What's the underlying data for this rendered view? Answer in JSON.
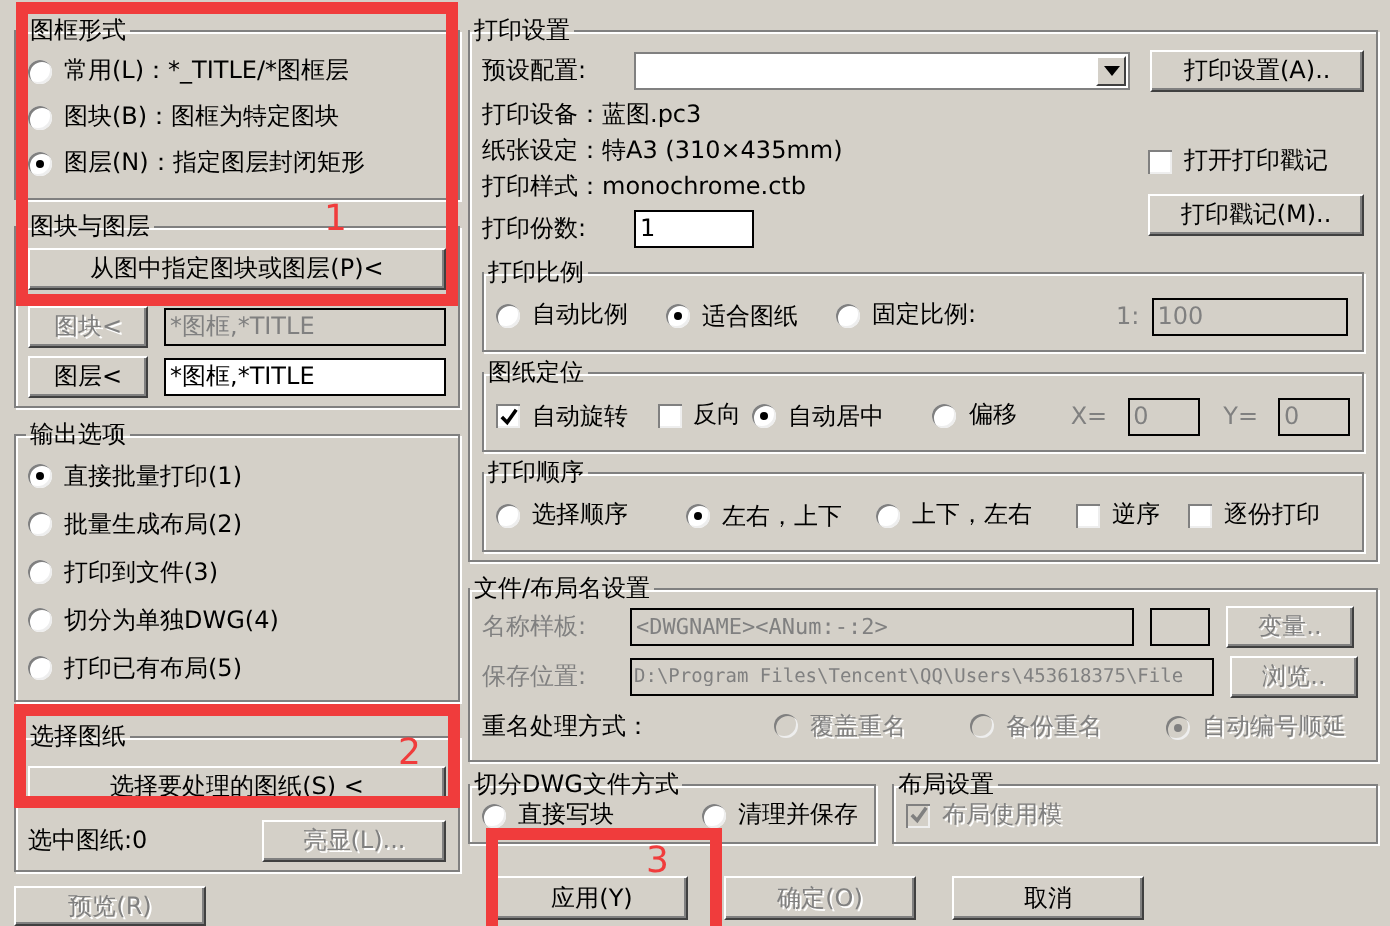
{
  "frame_style": {
    "title": "图框形式",
    "options": [
      {
        "label": "常用(L)：*_TITLE/*图框层",
        "selected": false
      },
      {
        "label": "图块(B)：图框为特定图块",
        "selected": false
      },
      {
        "label": "图层(N)：指定图层封闭矩形",
        "selected": true
      }
    ]
  },
  "block_layer": {
    "title": "图块与图层",
    "pick_button": "从图中指定图块或图层(P)<",
    "rows": [
      {
        "button": "图块<",
        "value": "*图框,*TITLE",
        "disabled": true
      },
      {
        "button": "图层<",
        "value": "*图框,*TITLE",
        "disabled": false
      }
    ]
  },
  "output": {
    "title": "输出选项",
    "options": [
      {
        "label": "直接批量打印(1)",
        "selected": true
      },
      {
        "label": "批量生成布局(2)",
        "selected": false
      },
      {
        "label": "打印到文件(3)",
        "selected": false
      },
      {
        "label": "切分为单独DWG(4)",
        "selected": false
      },
      {
        "label": "打印已有布局(5)",
        "selected": false
      }
    ]
  },
  "select_sheets": {
    "title": "选择图纸",
    "button": "选择要处理的图纸(S) <",
    "count": "选中图纸:0",
    "highlight_button": {
      "label": "亮显(L)...",
      "disabled": true
    }
  },
  "preview_button": {
    "label": "预览(R)",
    "disabled": true
  },
  "print_settings": {
    "title": "打印设置",
    "preset_label": "预设配置:",
    "setup_button": "打印设置(A)..",
    "info": [
      "打印设备：蓝图.pc3",
      "纸张设定：特A3 (310×435mm)",
      "打印样式：monochrome.ctb"
    ],
    "stamp_checkbox": {
      "label": "打开打印戳记",
      "checked": false
    },
    "stamp_button": "打印戳记(M)..",
    "copies_label": "打印份数:",
    "copies": "1",
    "scale": {
      "title": "打印比例",
      "options": [
        {
          "label": "自动比例",
          "selected": false
        },
        {
          "label": "适合图纸",
          "selected": true
        },
        {
          "label": "固定比例:",
          "selected": false
        }
      ],
      "ratio_label": "1:",
      "ratio": "100",
      "ratio_disabled": true
    },
    "placement": {
      "title": "图纸定位",
      "items": [
        {
          "kind": "checkbox",
          "label": "自动旋转",
          "checked": true
        },
        {
          "kind": "checkbox",
          "label": "反向",
          "checked": false
        },
        {
          "kind": "radio",
          "label": "自动居中",
          "selected": true
        },
        {
          "kind": "radio",
          "label": "偏移",
          "selected": false
        },
        {
          "kind": "field",
          "label": "X=",
          "value": "0",
          "disabled": true
        },
        {
          "kind": "field",
          "label": "Y=",
          "value": "0",
          "disabled": true
        }
      ]
    },
    "order": {
      "title": "打印顺序",
      "items": [
        {
          "kind": "radio",
          "label": "选择顺序",
          "selected": false
        },
        {
          "kind": "radio",
          "label": "左右，上下",
          "selected": true
        },
        {
          "kind": "radio",
          "label": "上下，左右",
          "selected": false
        },
        {
          "kind": "checkbox",
          "label": "逆序",
          "checked": false
        },
        {
          "kind": "checkbox",
          "label": "逐份打印",
          "checked": false
        }
      ]
    }
  },
  "file_names": {
    "title": "文件/布局名设置",
    "disabled": true,
    "template_label": "名称样板:",
    "template": "<DWGNAME><ANum:-:2>",
    "variables_button": "变量..",
    "save_label": "保存位置:",
    "save_path": "D:\\Program Files\\Tencent\\QQ\\Users\\453618375\\File",
    "browse_button": "浏览..",
    "rename_label": "重名处理方式：",
    "rename_options": [
      {
        "label": "覆盖重名",
        "selected": false
      },
      {
        "label": "备份重名",
        "selected": false
      },
      {
        "label": "自动编号顺延",
        "selected": true
      }
    ]
  },
  "split_dwg": {
    "title": "切分DWG文件方式",
    "options": [
      {
        "label": "直接写块",
        "selected": false
      },
      {
        "label": "清理并保存",
        "selected": false
      }
    ]
  },
  "layout": {
    "title": "布局设置",
    "checkbox": {
      "label": "布局使用模",
      "checked": true,
      "disabled": true
    }
  },
  "buttons": [
    {
      "label": "应用(Y)",
      "disabled": false
    },
    {
      "label": "确定(O)",
      "disabled": true
    },
    {
      "label": "取消",
      "disabled": false
    }
  ],
  "annotations": [
    {
      "label": "1"
    },
    {
      "label": "2"
    },
    {
      "label": "3"
    }
  ]
}
